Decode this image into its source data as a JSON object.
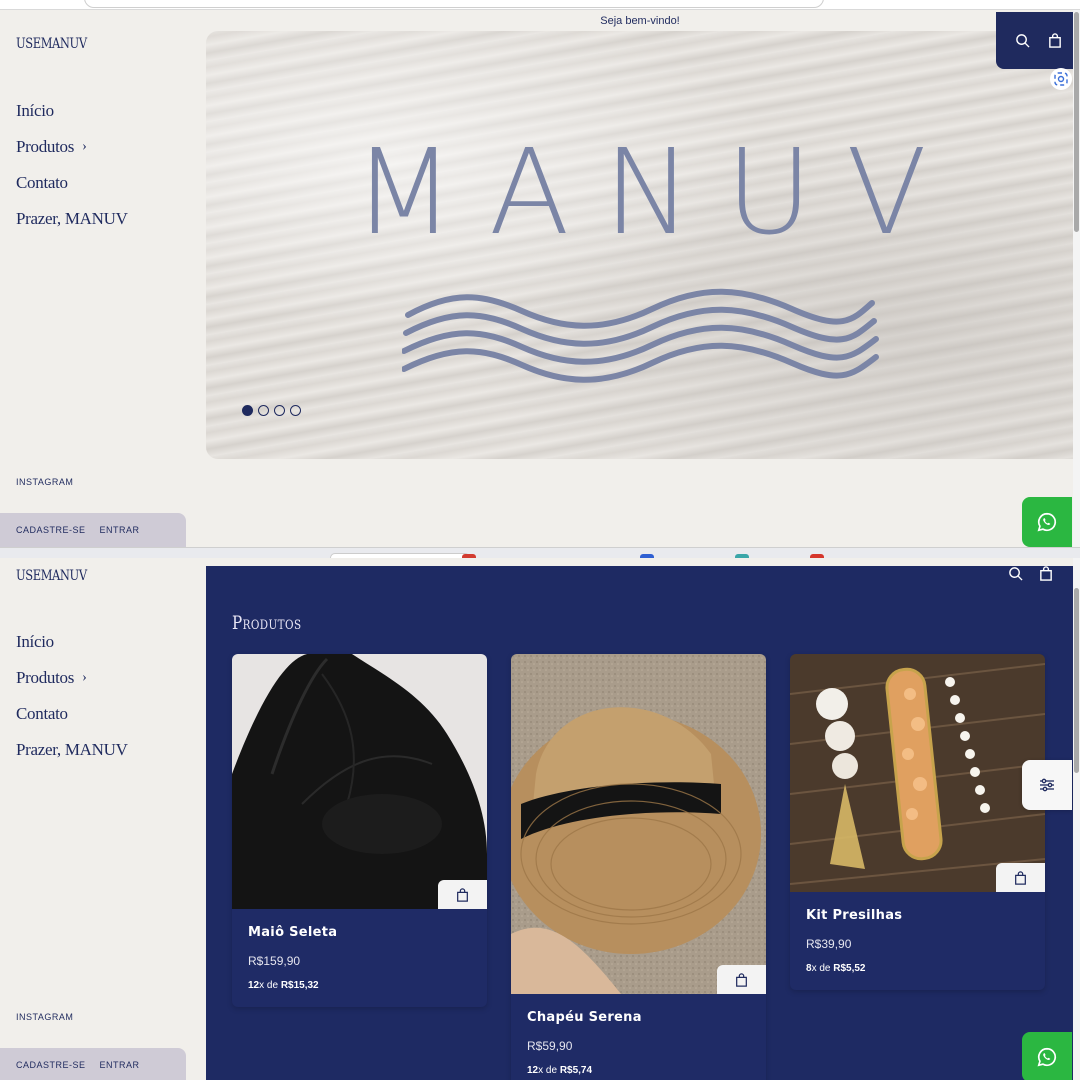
{
  "brand": "USEMANUV",
  "nav": [
    {
      "label": "Início"
    },
    {
      "label": "Produtos",
      "has_submenu": true
    },
    {
      "label": "Contato"
    },
    {
      "label": "Prazer, MANUV"
    }
  ],
  "social": {
    "instagram": "INSTAGRAM"
  },
  "account": {
    "signup": "CADASTRE-SE",
    "login": "ENTRAR"
  },
  "welcome_bar": "Seja bem-vindo!",
  "hero": {
    "title": "MANUV",
    "slides_total": 4,
    "active_slide": 1
  },
  "products_section": {
    "title": "Produtos",
    "items": [
      {
        "name": "Maiô Seleta",
        "price": "R$159,90",
        "installments_count": "12",
        "installments_sep": "x de",
        "installment_value": "R$15,32"
      },
      {
        "name": "Chapéu Serena",
        "price": "R$59,90",
        "installments_count": "12",
        "installments_sep": "x de",
        "installment_value": "R$5,74"
      },
      {
        "name": "Kit Presilhas",
        "price": "R$39,90",
        "installments_count": "8",
        "installments_sep": "x de",
        "installment_value": "R$5,52"
      }
    ]
  },
  "icons": {
    "search": "search-icon",
    "cart": "shopping-bag-icon",
    "whatsapp": "whatsapp-icon",
    "filter": "filter-sliders-icon",
    "chevron": "chevron-right-icon",
    "lens": "google-lens-icon"
  },
  "colors": {
    "navy": "#1f2a5e",
    "panel": "#1e2a63",
    "background": "#f1efeb",
    "whatsapp": "#2bb741",
    "hero_text": "#7b85a6"
  }
}
